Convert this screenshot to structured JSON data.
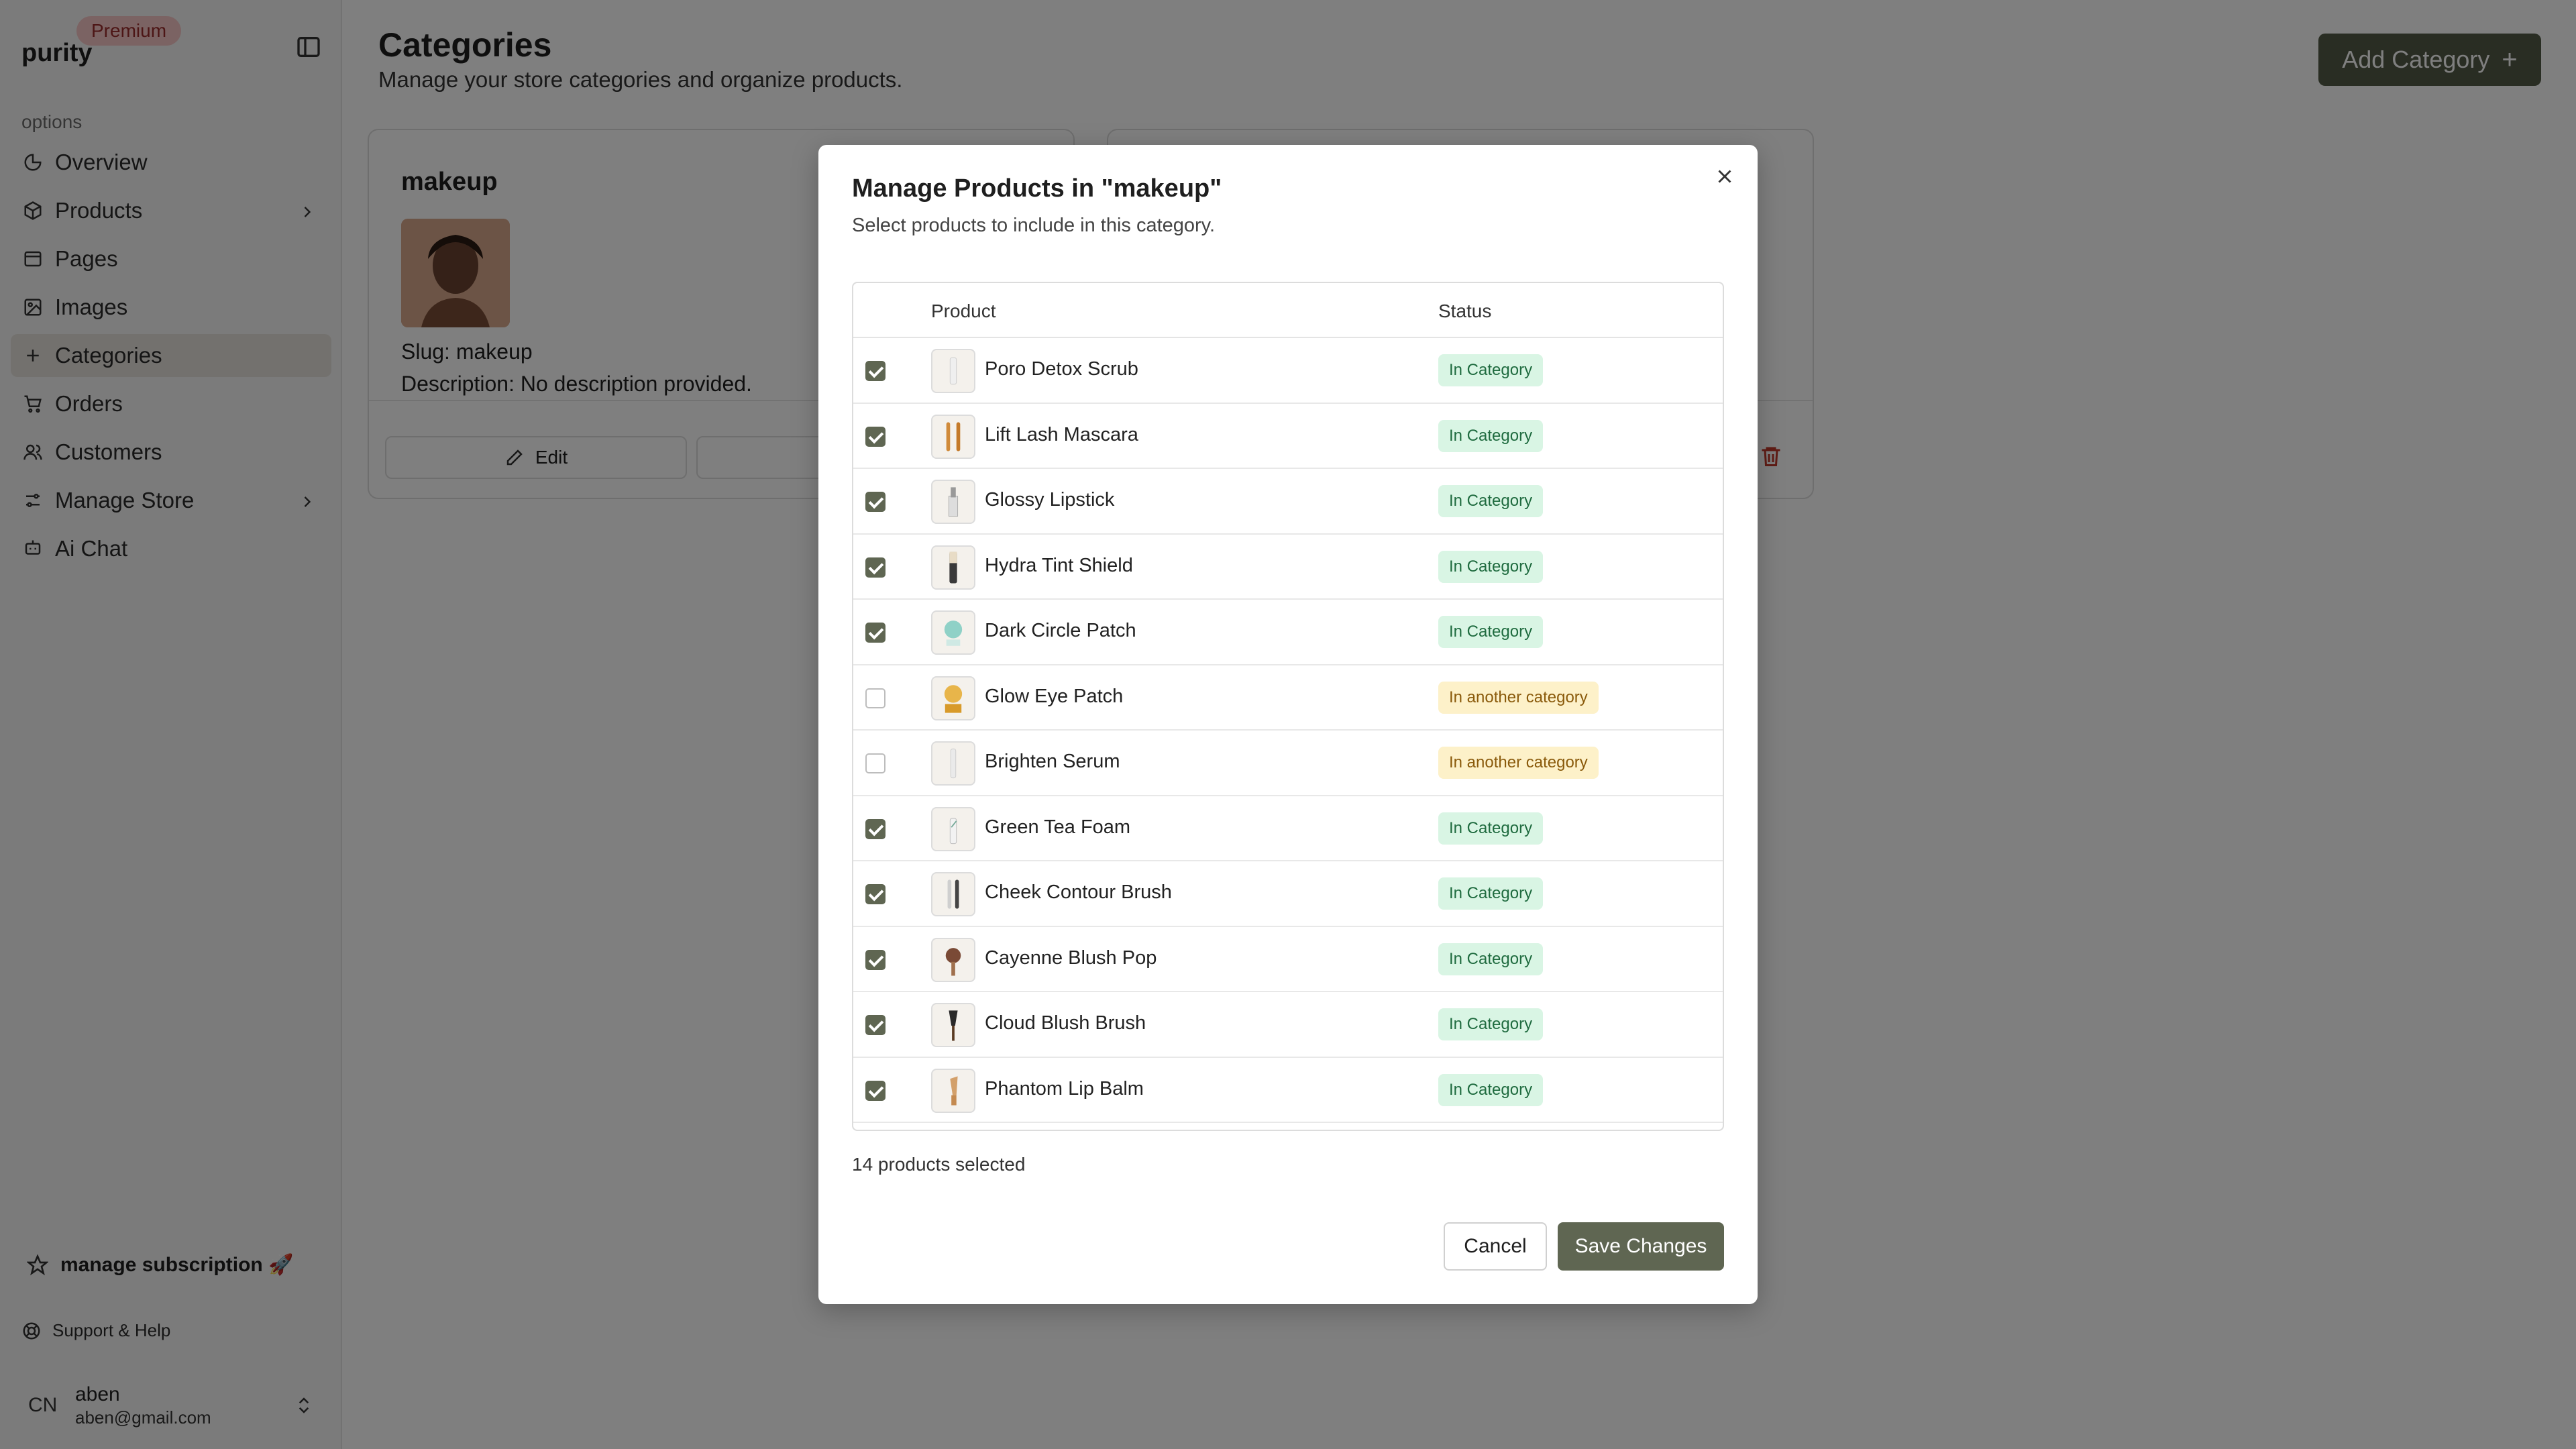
{
  "sidebar": {
    "brand": "purity",
    "premium": "Premium",
    "section_label": "options",
    "items": [
      {
        "label": "Overview"
      },
      {
        "label": "Products"
      },
      {
        "label": "Pages"
      },
      {
        "label": "Images"
      },
      {
        "label": "Categories"
      },
      {
        "label": "Orders"
      },
      {
        "label": "Customers"
      },
      {
        "label": "Manage Store"
      },
      {
        "label": "Ai Chat"
      }
    ],
    "manage_subscription": "manage subscription 🚀",
    "support": "Support & Help",
    "user": {
      "initials": "CN",
      "name": "aben",
      "email": "aben@gmail.com"
    }
  },
  "header": {
    "title": "Categories",
    "subtitle": "Manage your store categories and organize products.",
    "add_button": "Add Category",
    "add_icon": "+"
  },
  "card": {
    "title": "makeup",
    "slug": "Slug: makeup",
    "description": "Description: No description provided.",
    "edit_label": "Edit",
    "add_label": "+"
  },
  "modal": {
    "title": "Manage Products in \"makeup\"",
    "subtitle": "Select products to include in this category.",
    "columns": {
      "product": "Product",
      "status": "Status"
    },
    "rows": [
      {
        "name": "Poro Detox Scrub",
        "status": "In Category",
        "checked": true
      },
      {
        "name": "Lift Lash Mascara",
        "status": "In Category",
        "checked": true
      },
      {
        "name": "Glossy Lipstick",
        "status": "In Category",
        "checked": true
      },
      {
        "name": "Hydra Tint Shield",
        "status": "In Category",
        "checked": true
      },
      {
        "name": "Dark Circle Patch",
        "status": "In Category",
        "checked": true
      },
      {
        "name": "Glow Eye Patch",
        "status": "In another category",
        "checked": false
      },
      {
        "name": "Brighten Serum",
        "status": "In another category",
        "checked": false
      },
      {
        "name": "Green Tea Foam",
        "status": "In Category",
        "checked": true
      },
      {
        "name": "Cheek Contour Brush",
        "status": "In Category",
        "checked": true
      },
      {
        "name": "Cayenne Blush Pop",
        "status": "In Category",
        "checked": true
      },
      {
        "name": "Cloud Blush Brush",
        "status": "In Category",
        "checked": true
      },
      {
        "name": "Phantom Lip Balm",
        "status": "In Category",
        "checked": true
      }
    ],
    "selected_count": "14 products selected",
    "cancel_label": "Cancel",
    "save_label": "Save Changes"
  },
  "colors": {
    "accent": "#5f6652",
    "badge_in_bg": "#d9f5e4",
    "badge_other_bg": "#fdf1c9"
  }
}
